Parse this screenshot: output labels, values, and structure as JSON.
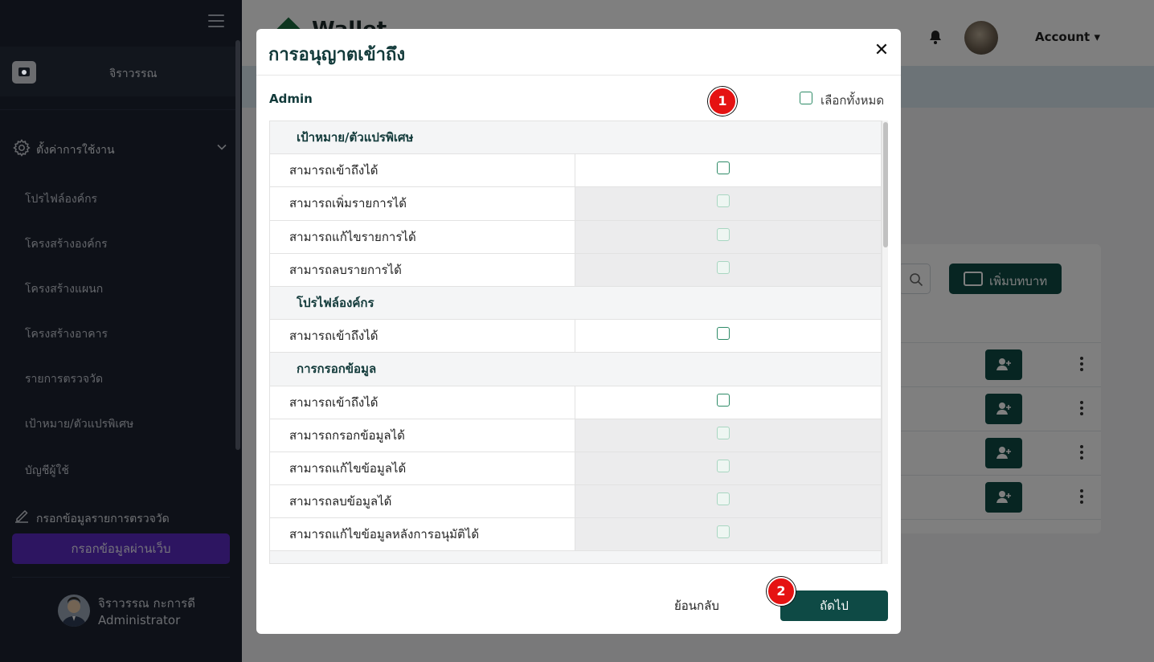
{
  "sidebar": {
    "brand_name": "จิราวรรณ",
    "settings_label": "ตั้งค่าการใช้งาน",
    "items": [
      {
        "label": "โปรไฟล์องค์กร"
      },
      {
        "label": "โครงสร้างองค์กร"
      },
      {
        "label": "โครงสร้างแผนก"
      },
      {
        "label": "โครงสร้างอาคาร"
      },
      {
        "label": "รายการตรวจวัด"
      },
      {
        "label": "เป้าหมาย/ตัวแปรพิเศษ"
      },
      {
        "label": "บัญชีผู้ใช้"
      }
    ],
    "entry_label": "กรอกข้อมูลรายการตรวจวัด",
    "web_entry_button": "กรอกข้อมูลผ่านเว็บ",
    "user": {
      "name": "จิราวรรณ กะการดี",
      "role": "Administrator"
    }
  },
  "header": {
    "logo_text": "Wallet",
    "account_label": "Account ▾"
  },
  "background": {
    "add_role_label": "เพิ่มบทบาท"
  },
  "modal": {
    "title": "การอนุญาตเข้าถึง",
    "close_symbol": "✕",
    "role_name": "Admin",
    "select_all_label": "เลือกทั้งหมด",
    "badges": [
      "1",
      "2"
    ],
    "sections": [
      {
        "title": "เป้าหมาย/ตัวแปรพิเศษ",
        "permissions": [
          {
            "label": "สามารถเข้าถึงได้",
            "enabled": true
          },
          {
            "label": "สามารถเพิ่มรายการได้",
            "enabled": false
          },
          {
            "label": "สามารถแก้ไขรายการได้",
            "enabled": false
          },
          {
            "label": "สามารถลบรายการได้",
            "enabled": false
          }
        ]
      },
      {
        "title": "โปรไฟล์องค์กร",
        "permissions": [
          {
            "label": "สามารถเข้าถึงได้",
            "enabled": true
          }
        ]
      },
      {
        "title": "การกรอกข้อมูล",
        "permissions": [
          {
            "label": "สามารถเข้าถึงได้",
            "enabled": true
          },
          {
            "label": "สามารถกรอกข้อมูลได้",
            "enabled": false
          },
          {
            "label": "สามารถแก้ไขข้อมูลได้",
            "enabled": false
          },
          {
            "label": "สามารถลบข้อมูลได้",
            "enabled": false
          },
          {
            "label": "สามารถแก้ไขข้อมูลหลังการอนุมัติได้",
            "enabled": false
          }
        ]
      }
    ],
    "back_label": "ย้อนกลับ",
    "next_label": "ถัดไป"
  }
}
